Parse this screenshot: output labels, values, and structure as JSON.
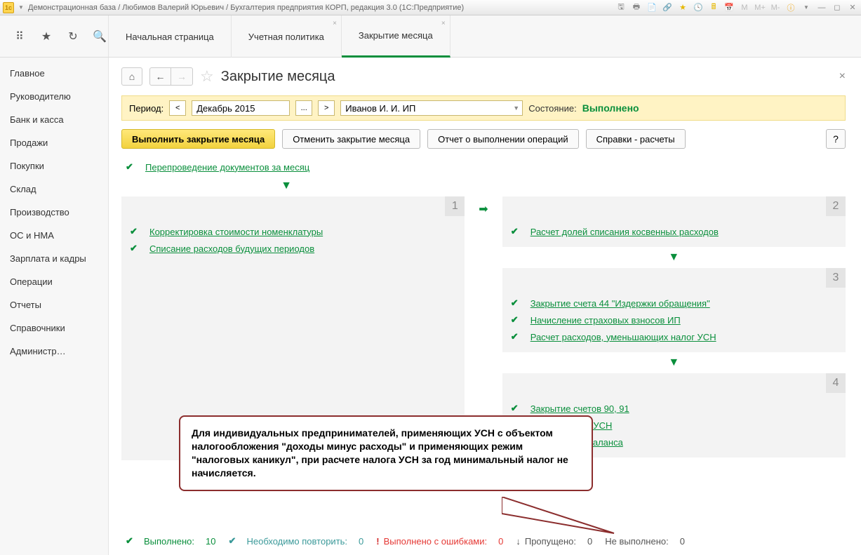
{
  "window": {
    "title": "Демонстрационная база / Любимов Валерий Юрьевич / Бухгалтерия предприятия КОРП, редакция 3.0  (1С:Предприятие)"
  },
  "tabs": [
    {
      "label": "Начальная страница",
      "closable": false,
      "active": false
    },
    {
      "label": "Учетная политика",
      "closable": true,
      "active": false
    },
    {
      "label": "Закрытие месяца",
      "closable": true,
      "active": true
    }
  ],
  "nav": [
    "Главное",
    "Руководителю",
    "Банк и касса",
    "Продажи",
    "Покупки",
    "Склад",
    "Производство",
    "ОС и НМА",
    "Зарплата и кадры",
    "Операции",
    "Отчеты",
    "Справочники",
    "Администр…"
  ],
  "page": {
    "title": "Закрытие месяца",
    "period_label": "Период:",
    "period": "Декабрь 2015",
    "org": "Иванов И. И. ИП",
    "status_label": "Состояние:",
    "status": "Выполнено"
  },
  "buttons": {
    "execute": "Выполнить закрытие месяца",
    "cancel": "Отменить закрытие месяца",
    "report": "Отчет о выполнении операций",
    "refs": "Справки - расчеты",
    "help": "?"
  },
  "ops": {
    "repost": "Перепроведение документов за месяц",
    "b1_0": "Корректировка стоимости номенклатуры",
    "b1_1": "Списание расходов будущих периодов",
    "b2_0": "Расчет долей списания косвенных расходов",
    "b3_0": "Закрытие счета 44 \"Издержки обращения\"",
    "b3_1": "Начисление страховых взносов ИП",
    "b3_2": "Расчет расходов, уменьшающих налог УСН",
    "b4_0": "Закрытие счетов 90, 91",
    "b4_1": "Расчет налога УСН",
    "b4_2": "Реформация баланса"
  },
  "footer": {
    "done": "Выполнено:",
    "done_n": "10",
    "repeat": "Необходимо повторить:",
    "repeat_n": "0",
    "err": "Выполнено с ошибками:",
    "err_n": "0",
    "skip": "Пропущено:",
    "skip_n": "0",
    "notdone": "Не выполнено:",
    "notdone_n": "0"
  },
  "callout": "Для индивидуальных предпринимателей, применяющих УСН с объектом налогообложения \"доходы минус расходы\" и применяющих режим \"налоговых каникул\", при расчете налога УСН за год минимальный налог не начисляется."
}
